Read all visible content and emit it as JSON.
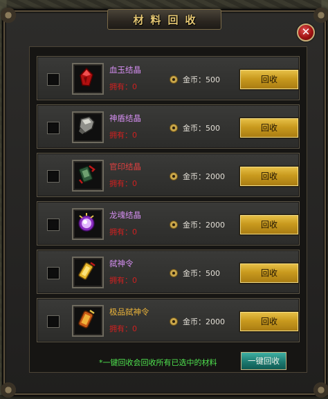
{
  "window": {
    "title": "材料回收",
    "close_label": "✕"
  },
  "items": [
    {
      "name": "血玉结晶",
      "name_color": "#d48ef0",
      "owned": "拥有：0",
      "price": "金币：500",
      "button": "回收",
      "icon": "red-crystal-icon"
    },
    {
      "name": "神盾结晶",
      "name_color": "#d48ef0",
      "owned": "拥有：0",
      "price": "金币：500",
      "button": "回收",
      "icon": "shield-crystal-icon"
    },
    {
      "name": "官印结晶",
      "name_color": "#e04040",
      "owned": "拥有：0",
      "price": "金币：2000",
      "button": "回收",
      "icon": "official-seal-icon"
    },
    {
      "name": "龙魂结晶",
      "name_color": "#d48ef0",
      "owned": "拥有：0",
      "price": "金币：2000",
      "button": "回收",
      "icon": "dragon-soul-orb-icon"
    },
    {
      "name": "弑神令",
      "name_color": "#d48ef0",
      "owned": "拥有：0",
      "price": "金币：500",
      "button": "回收",
      "icon": "gold-token-icon"
    },
    {
      "name": "极品弑神令",
      "name_color": "#e9b23a",
      "owned": "拥有：0",
      "price": "金币：2000",
      "button": "回收",
      "icon": "premium-token-icon"
    }
  ],
  "footer": {
    "note": "*一键回收会回收所有已选中的材料",
    "onekey_button": "一键回收"
  },
  "colors": {
    "gold_text": "#e6c874",
    "owned_red": "#d02020",
    "note_green": "#4fe24f"
  }
}
